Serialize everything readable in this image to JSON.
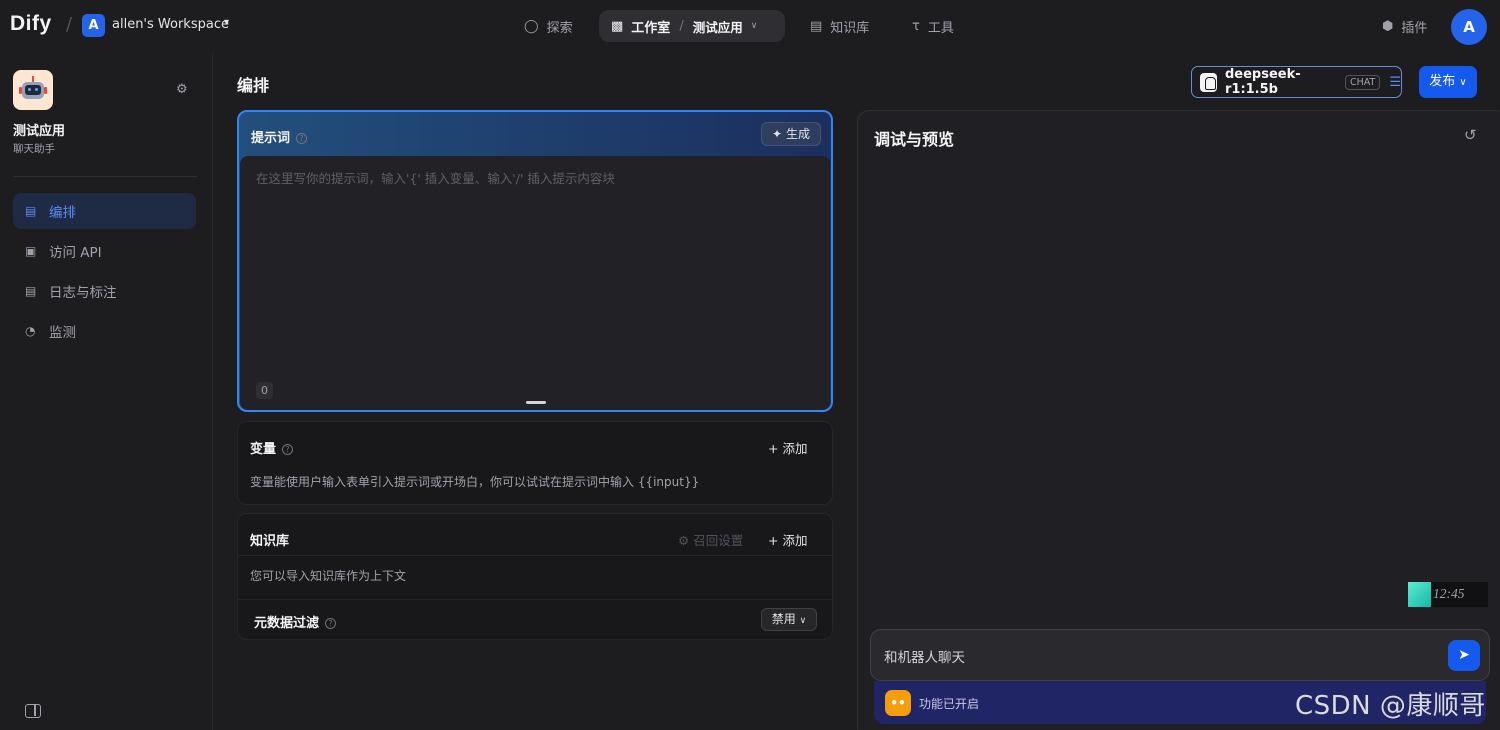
{
  "topbar": {
    "logo": "Dify",
    "workspace": {
      "avatar": "A",
      "name": "allen's Workspace"
    },
    "nav": {
      "explore": "探索",
      "studio": "工作室",
      "current_app": "测试应用",
      "knowledge": "知识库",
      "tools": "工具"
    },
    "plugins": "插件",
    "user_avatar": "A"
  },
  "sidebar": {
    "app_name": "测试应用",
    "app_type": "聊天助手",
    "items": [
      {
        "label": "编排",
        "icon": "layout-icon",
        "active": true
      },
      {
        "label": "访问 API",
        "icon": "terminal-icon",
        "active": false
      },
      {
        "label": "日志与标注",
        "icon": "document-icon",
        "active": false
      },
      {
        "label": "监测",
        "icon": "gauge-icon",
        "active": false
      }
    ]
  },
  "main": {
    "title": "编排",
    "model": {
      "name": "deepseek-r1:1.5b",
      "badge": "CHAT"
    },
    "publish": "发布",
    "prompt": {
      "title": "提示词",
      "generate": "生成",
      "placeholder": "在这里写你的提示词，输入'{' 插入变量、输入'/' 插入提示内容块",
      "char_count": "0"
    },
    "variables": {
      "title": "变量",
      "add": "添加",
      "desc": "变量能使用户输入表单引入提示词或开场白，你可以试试在提示词中输入 {{input}}"
    },
    "knowledge": {
      "title": "知识库",
      "recall": "召回设置",
      "add": "添加",
      "desc": "您可以导入知识库作为上下文",
      "metadata_title": "元数据过滤",
      "metadata_value": "禁用"
    }
  },
  "debug": {
    "title": "调试与预览",
    "input_placeholder": "和机器人聊天",
    "feature_text": "功能已开启",
    "thumb_time": "12:45"
  },
  "watermark": "CSDN @康顺哥",
  "colors": {
    "accent": "#155aef",
    "active_nav": "#5b8def",
    "background": "#1d1d20"
  }
}
